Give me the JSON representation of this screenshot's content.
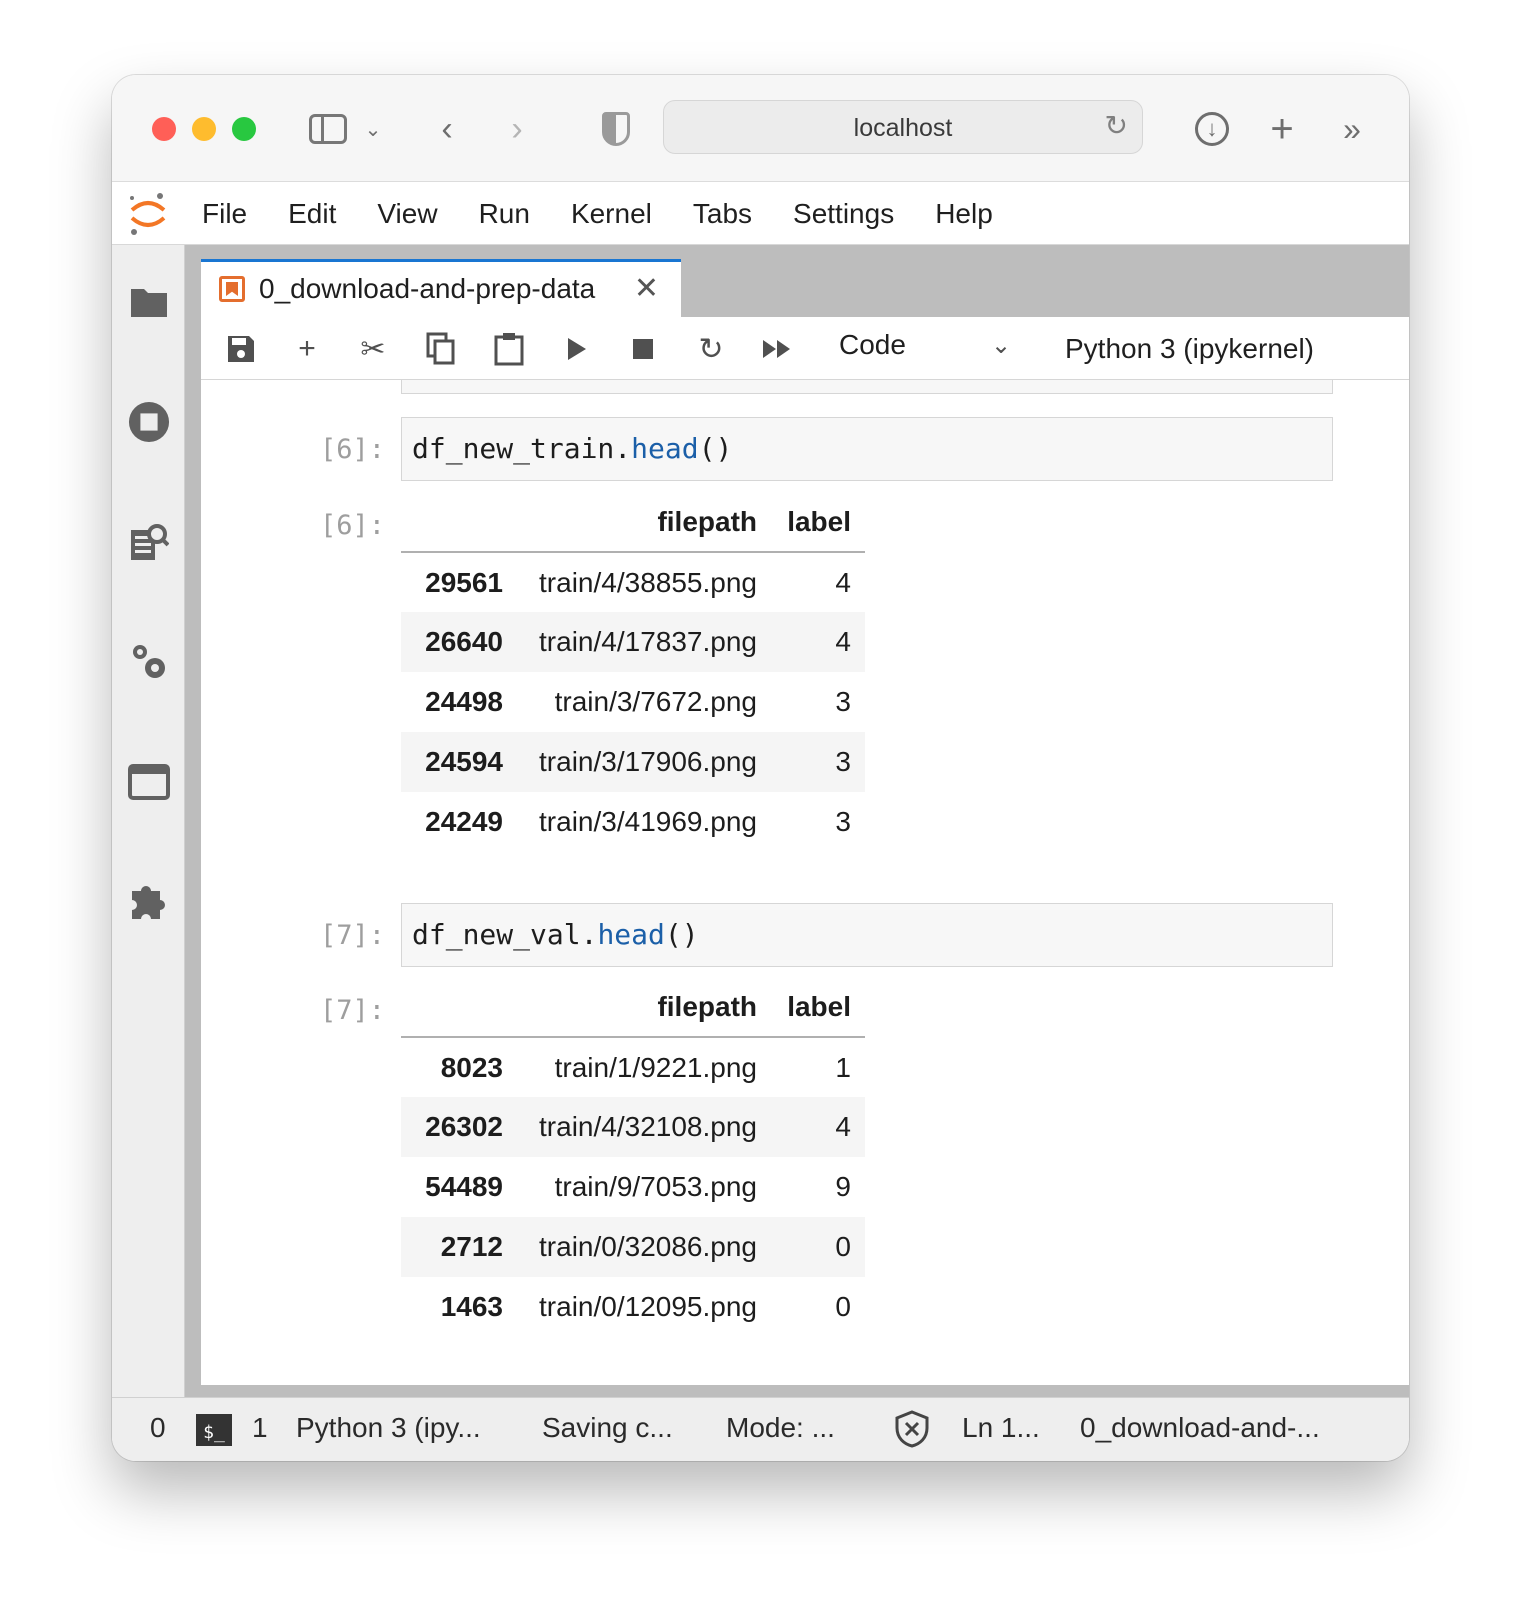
{
  "browser": {
    "url": "localhost"
  },
  "menu": [
    "File",
    "Edit",
    "View",
    "Run",
    "Kernel",
    "Tabs",
    "Settings",
    "Help"
  ],
  "tab": {
    "title": "0_download-and-prep-data"
  },
  "toolbar": {
    "cell_type": "Code",
    "kernel": "Python 3 (ipykernel)"
  },
  "cells": [
    {
      "in_prompt": "[6]:",
      "code_obj": "df_new_train.",
      "code_fn": "head",
      "code_tail": "()",
      "out_prompt": "[6]:",
      "columns": [
        "filepath",
        "label"
      ],
      "rows": [
        {
          "index": "29561",
          "filepath": "train/4/38855.png",
          "label": "4"
        },
        {
          "index": "26640",
          "filepath": "train/4/17837.png",
          "label": "4"
        },
        {
          "index": "24498",
          "filepath": "train/3/7672.png",
          "label": "3"
        },
        {
          "index": "24594",
          "filepath": "train/3/17906.png",
          "label": "3"
        },
        {
          "index": "24249",
          "filepath": "train/3/41969.png",
          "label": "3"
        }
      ]
    },
    {
      "in_prompt": "[7]:",
      "code_obj": "df_new_val.",
      "code_fn": "head",
      "code_tail": "()",
      "out_prompt": "[7]:",
      "columns": [
        "filepath",
        "label"
      ],
      "rows": [
        {
          "index": "8023",
          "filepath": "train/1/9221.png",
          "label": "1"
        },
        {
          "index": "26302",
          "filepath": "train/4/32108.png",
          "label": "4"
        },
        {
          "index": "54489",
          "filepath": "train/9/7053.png",
          "label": "9"
        },
        {
          "index": "2712",
          "filepath": "train/0/32086.png",
          "label": "0"
        },
        {
          "index": "1463",
          "filepath": "train/0/12095.png",
          "label": "0"
        }
      ]
    }
  ],
  "status": {
    "simple_count": "0",
    "terminal_count": "1",
    "kernel": "Python 3 (ipy...",
    "saving": "Saving c...",
    "mode": "Mode: ...",
    "position": "Ln 1...",
    "file": "0_download-and-..."
  },
  "colors": {
    "accent": "#1976d2",
    "notebook_icon": "#e46e2e",
    "code_function": "#1b5fa8"
  }
}
